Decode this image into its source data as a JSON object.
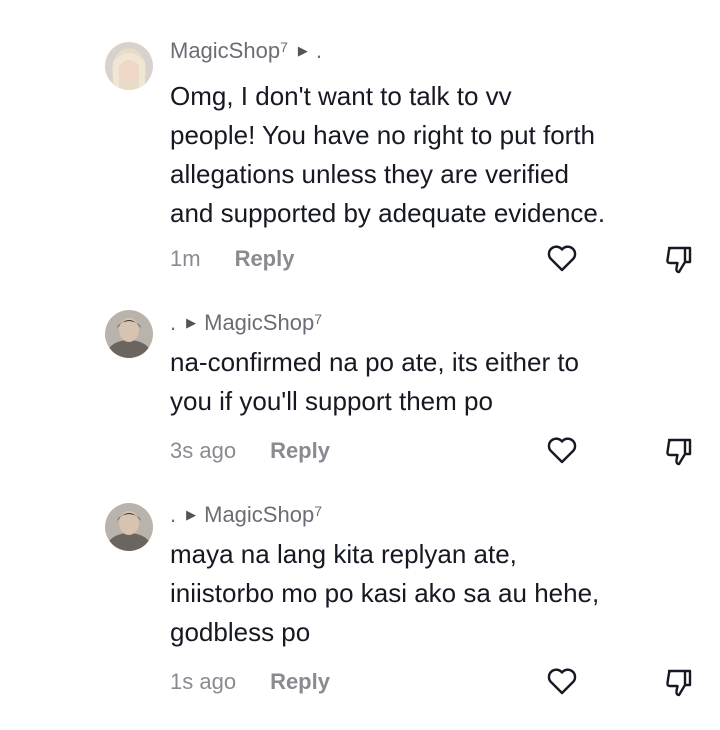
{
  "comments": [
    {
      "prefix": "",
      "author": "MagicShop",
      "author_sup": "7",
      "suffix": ".",
      "lines": [
        "Omg, I don't want to talk to vv",
        "people! You have no right to put forth",
        "allegations unless they are verified",
        "and supported by adequate evidence."
      ],
      "time": "1m",
      "reply_label": "Reply",
      "avatar_icon": "avatar-blonde"
    },
    {
      "prefix": ".",
      "author": "MagicShop",
      "author_sup": "7",
      "suffix": "",
      "lines": [
        "na-confirmed na po ate, its either to",
        "you if you'll support them po"
      ],
      "time": "3s ago",
      "reply_label": "Reply",
      "avatar_icon": "avatar-dark"
    },
    {
      "prefix": ".",
      "author": "MagicShop",
      "author_sup": "7",
      "suffix": "",
      "lines": [
        "maya na lang kita replyan ate,",
        "iniistorbo mo po kasi ako sa au hehe,",
        "godbless po"
      ],
      "time": "1s ago",
      "reply_label": "Reply",
      "avatar_icon": "avatar-dark"
    }
  ],
  "icons": {
    "like": "heart-outline-icon",
    "dislike": "thumbs-down-icon",
    "reply_arrow": "play-triangle-icon"
  },
  "colors": {
    "text": "#161823",
    "muted": "#8a8b91",
    "icon": "#161823"
  }
}
